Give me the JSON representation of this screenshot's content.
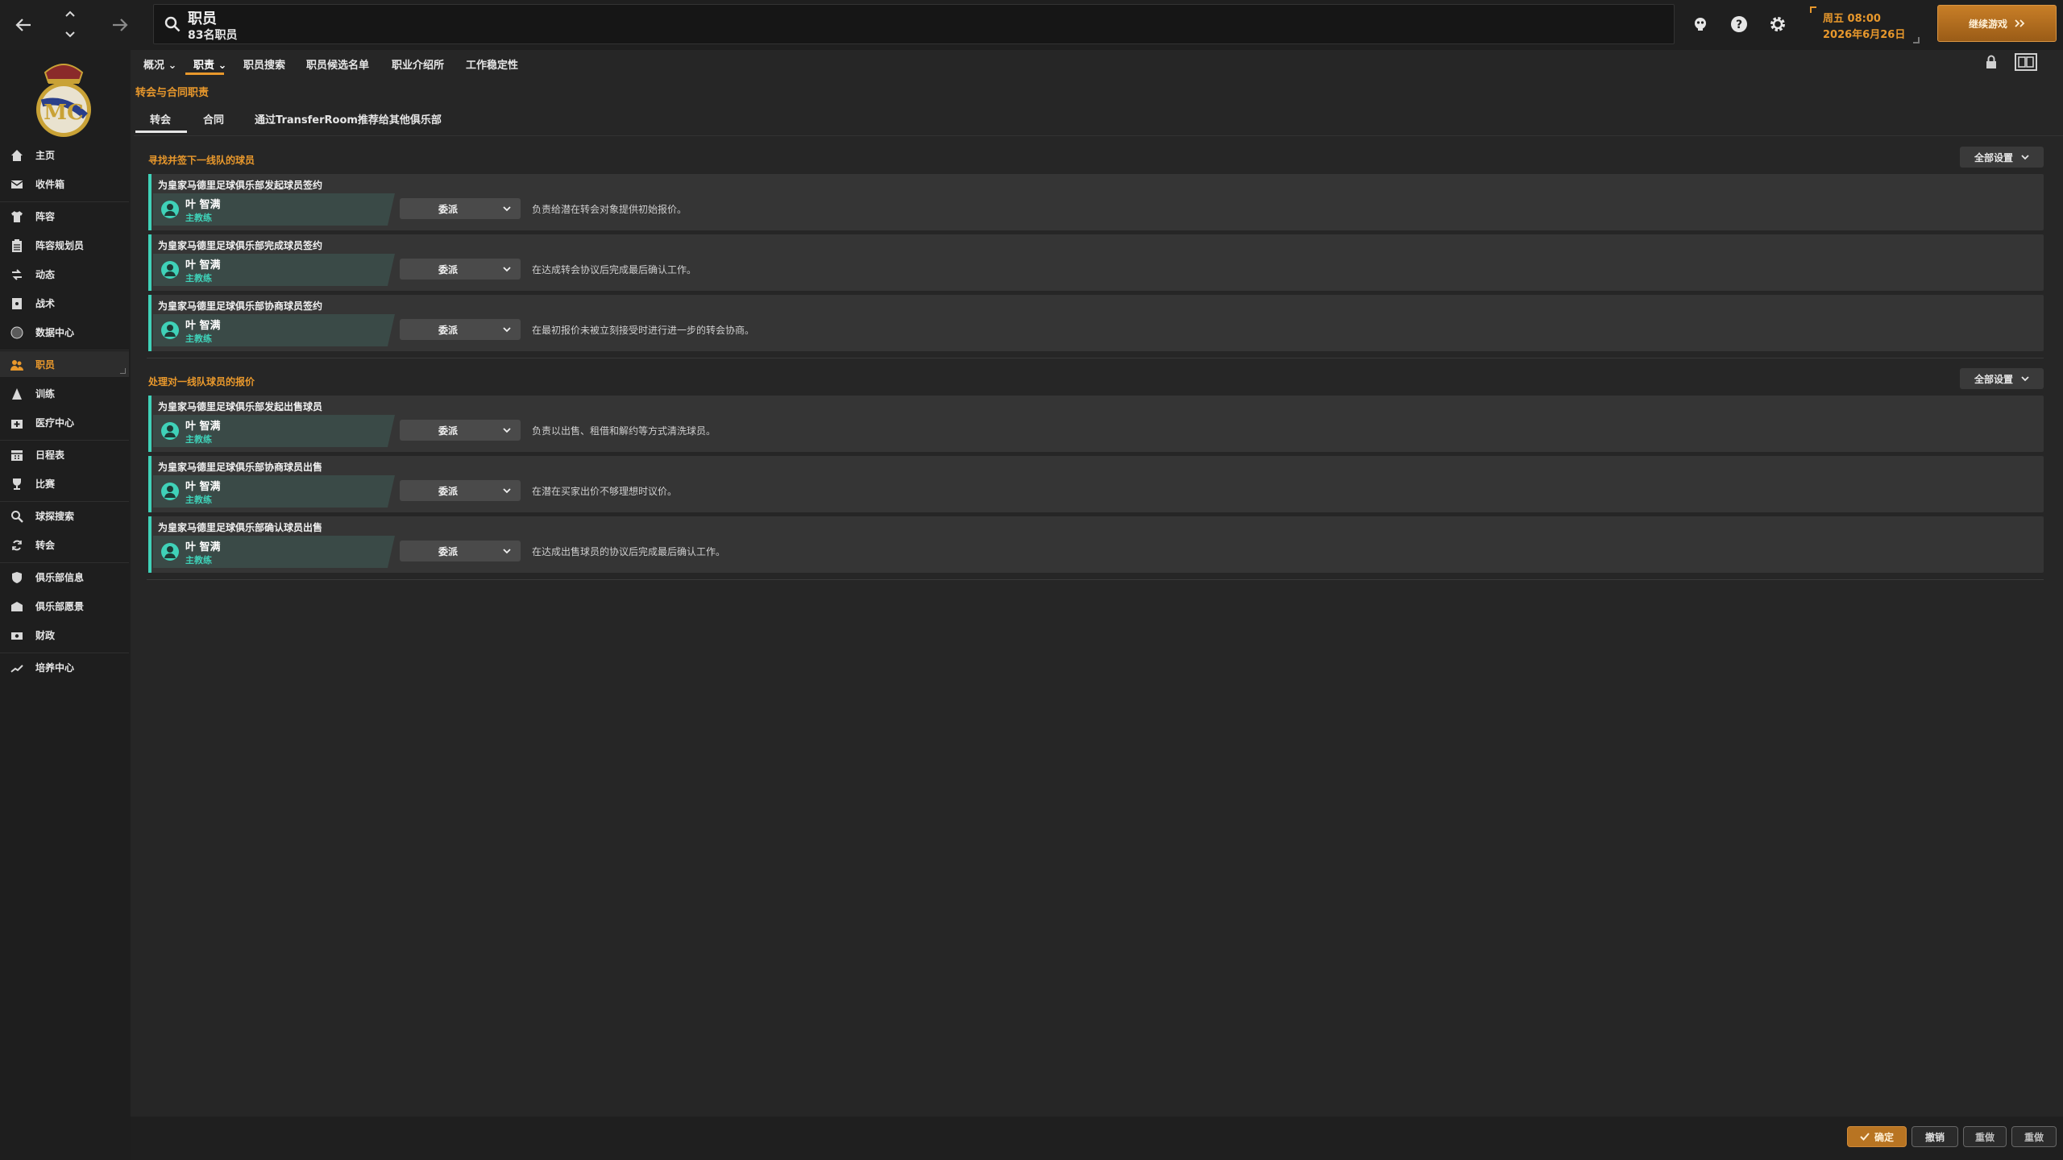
{
  "topbar": {
    "title": "职员",
    "subtitle": "83名职员",
    "date_time": "周五 08:00",
    "date_day": "2026年6月26日",
    "continue_label": "继续游戏"
  },
  "sidebar": {
    "items": [
      {
        "label": "主页",
        "icon": "home-icon"
      },
      {
        "label": "收件箱",
        "icon": "inbox-icon"
      },
      {
        "label": "阵容",
        "icon": "shirt-icon"
      },
      {
        "label": "阵容规划员",
        "icon": "clipboard-icon"
      },
      {
        "label": "动态",
        "icon": "dynamics-icon"
      },
      {
        "label": "战术",
        "icon": "tactics-icon"
      },
      {
        "label": "数据中心",
        "icon": "data-icon"
      },
      {
        "label": "职员",
        "icon": "staff-icon"
      },
      {
        "label": "训练",
        "icon": "training-icon"
      },
      {
        "label": "医疗中心",
        "icon": "medical-icon"
      },
      {
        "label": "日程表",
        "icon": "calendar-icon"
      },
      {
        "label": "比赛",
        "icon": "trophy-icon"
      },
      {
        "label": "球探搜索",
        "icon": "scout-icon"
      },
      {
        "label": "转会",
        "icon": "transfer-icon"
      },
      {
        "label": "俱乐部信息",
        "icon": "shield-icon"
      },
      {
        "label": "俱乐部愿景",
        "icon": "vision-icon"
      },
      {
        "label": "财政",
        "icon": "finance-icon"
      },
      {
        "label": "培养中心",
        "icon": "development-icon"
      }
    ]
  },
  "subnav": {
    "tabs": [
      "概况",
      "职责",
      "职员搜索",
      "职员候选名单",
      "职业介绍所",
      "工作稳定性"
    ]
  },
  "section_title": "转会与合同职责",
  "tabs": [
    "转会",
    "合同",
    "通过TransferRoom推荐给其他俱乐部"
  ],
  "groups": [
    {
      "title": "寻找并签下一线队的球员",
      "button": "全部设置",
      "cards": [
        {
          "title": "为皇家马德里足球俱乐部发起球员签约",
          "name": "叶 智满",
          "role": "主教练",
          "select": "委派",
          "desc": "负责给潜在转会对象提供初始报价。"
        },
        {
          "title": "为皇家马德里足球俱乐部完成球员签约",
          "name": "叶 智满",
          "role": "主教练",
          "select": "委派",
          "desc": "在达成转会协议后完成最后确认工作。"
        },
        {
          "title": "为皇家马德里足球俱乐部协商球员签约",
          "name": "叶 智满",
          "role": "主教练",
          "select": "委派",
          "desc": "在最初报价未被立刻接受时进行进一步的转会协商。"
        }
      ]
    },
    {
      "title": "处理对一线队球员的报价",
      "button": "全部设置",
      "cards": [
        {
          "title": "为皇家马德里足球俱乐部发起出售球员",
          "name": "叶 智满",
          "role": "主教练",
          "select": "委派",
          "desc": "负责以出售、租借和解约等方式清洗球员。"
        },
        {
          "title": "为皇家马德里足球俱乐部协商球员出售",
          "name": "叶 智满",
          "role": "主教练",
          "select": "委派",
          "desc": "在潜在买家出价不够理想时议价。"
        },
        {
          "title": "为皇家马德里足球俱乐部确认球员出售",
          "name": "叶 智满",
          "role": "主教练",
          "select": "委派",
          "desc": "在达成出售球员的协议后完成最后确认工作。"
        }
      ]
    }
  ],
  "bottombar": {
    "confirm": "确定",
    "cancel": "撤销",
    "reset": "重做",
    "default": "重做"
  },
  "colors": {
    "accent": "#e8982c",
    "teal": "#3fd1b8",
    "background": "#262626"
  }
}
